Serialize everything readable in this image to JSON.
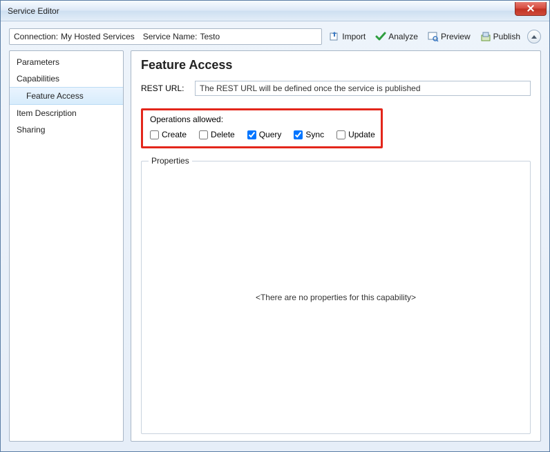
{
  "window": {
    "title": "Service Editor"
  },
  "toolbar": {
    "connection_label": "Connection:",
    "connection_value": "My Hosted Services",
    "service_name_label": "Service Name:",
    "service_name_value": "Testo",
    "import_label": "Import",
    "analyze_label": "Analyze",
    "preview_label": "Preview",
    "publish_label": "Publish"
  },
  "sidebar": {
    "items": [
      {
        "label": "Parameters",
        "child": false,
        "selected": false
      },
      {
        "label": "Capabilities",
        "child": false,
        "selected": false
      },
      {
        "label": "Feature Access",
        "child": true,
        "selected": true
      },
      {
        "label": "Item Description",
        "child": false,
        "selected": false
      },
      {
        "label": "Sharing",
        "child": false,
        "selected": false
      }
    ]
  },
  "panel": {
    "heading": "Feature Access",
    "rest_label": "REST URL:",
    "rest_value": "The REST URL will be defined once the service is published",
    "ops_title": "Operations allowed:",
    "operations": [
      {
        "label": "Create",
        "checked": false
      },
      {
        "label": "Delete",
        "checked": false
      },
      {
        "label": "Query",
        "checked": true
      },
      {
        "label": "Sync",
        "checked": true
      },
      {
        "label": "Update",
        "checked": false
      }
    ],
    "properties_legend": "Properties",
    "properties_empty": "<There are no properties for this capability>"
  }
}
